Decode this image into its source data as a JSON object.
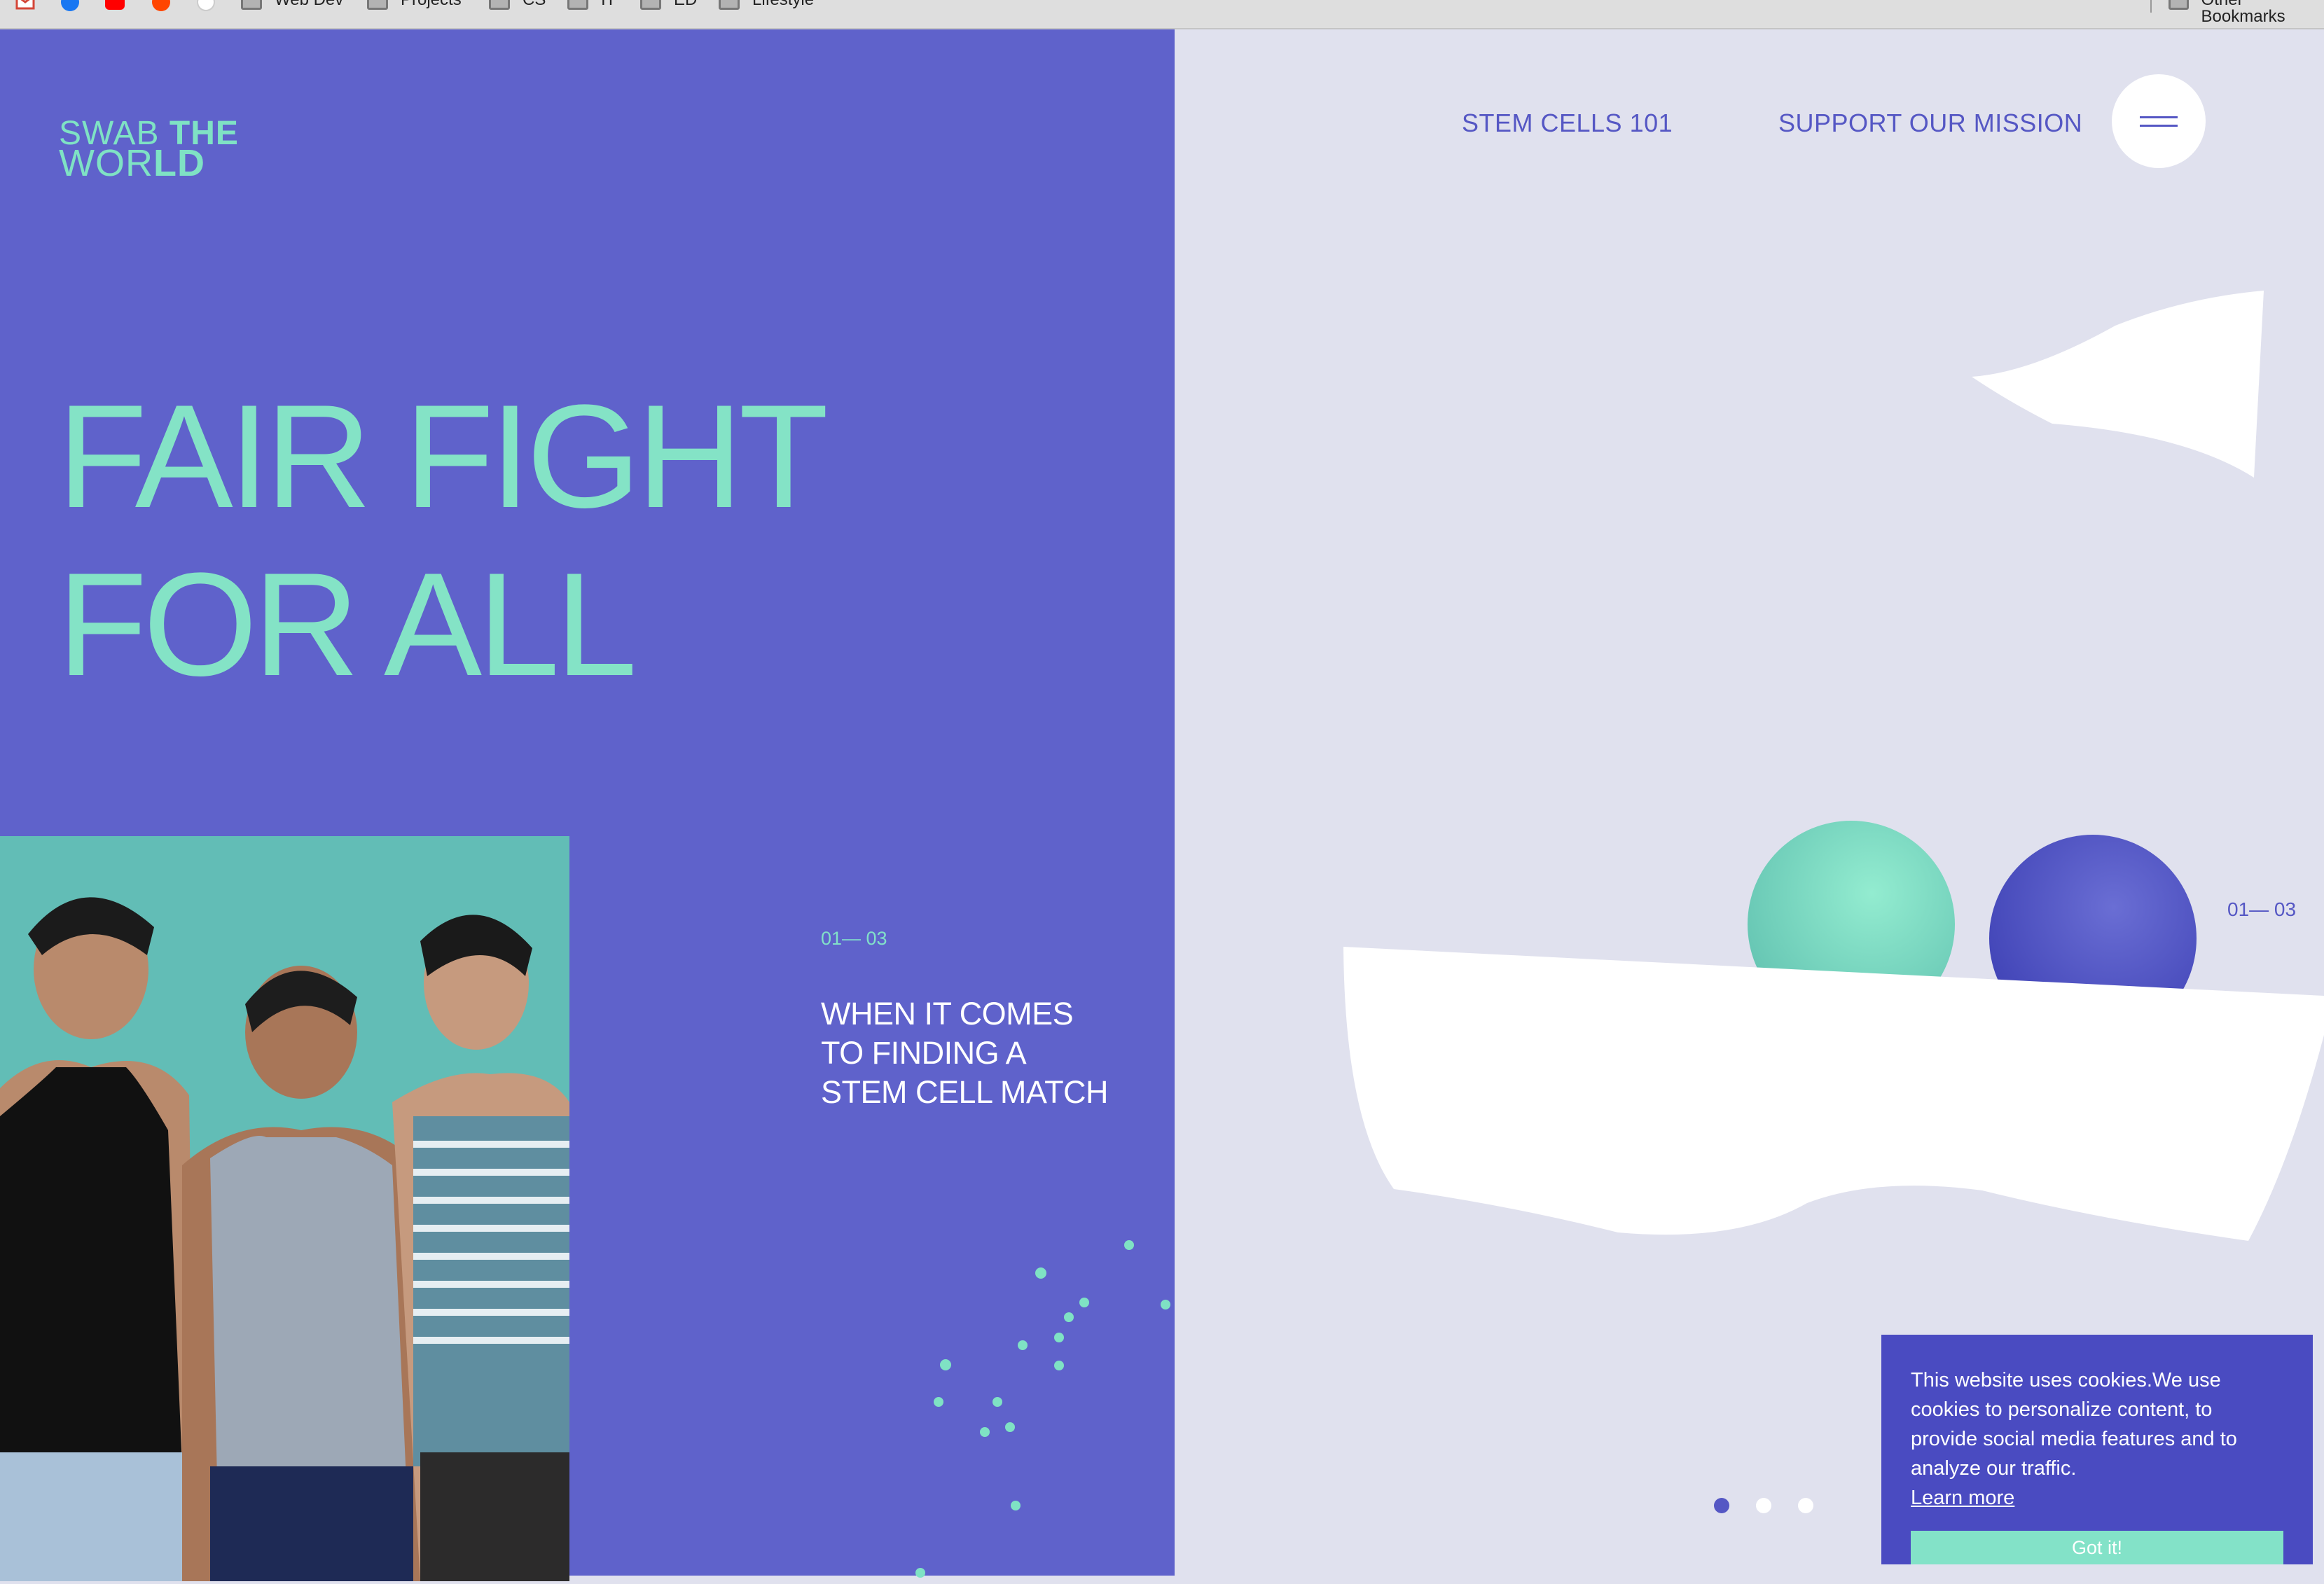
{
  "bookmarks_bar": {
    "folders": [
      "Web Dev",
      "Projects",
      "CS",
      "IT",
      "ED",
      "Lifestyle"
    ],
    "other": "Other Bookmarks",
    "icons": [
      "gmail-icon",
      "facebook-icon",
      "youtube-icon",
      "reddit-icon",
      "github-icon"
    ]
  },
  "brand": {
    "logo_line1_light": "SWAB ",
    "logo_line1_bold": "THE",
    "logo_line2_light": "WOR",
    "logo_line2_bold": "LD"
  },
  "nav": {
    "link1": "STEM CELLS 101",
    "link2": "SUPPORT OUR MISSION",
    "menu_icon": "hamburger-icon"
  },
  "hero": {
    "line1": "FAIR FIGHT",
    "line2": "FOR ALL"
  },
  "slide": {
    "counter": "01— 03",
    "caption": "WHEN IT COMES TO FINDING A STEM CELL MATCH",
    "active_index": 1,
    "total": 3
  },
  "cookie": {
    "text": "This website uses cookies.We use cookies to personalize content, to provide social media features and to analyze our traffic.",
    "learn_more": "Learn more",
    "button": "Got it!"
  },
  "colors": {
    "purple": "#5f62cb",
    "mint": "#84e3c6",
    "light_bg": "#e0e1ee",
    "cookie_bg": "#4a4bc1",
    "nav_text": "#5557c4"
  }
}
